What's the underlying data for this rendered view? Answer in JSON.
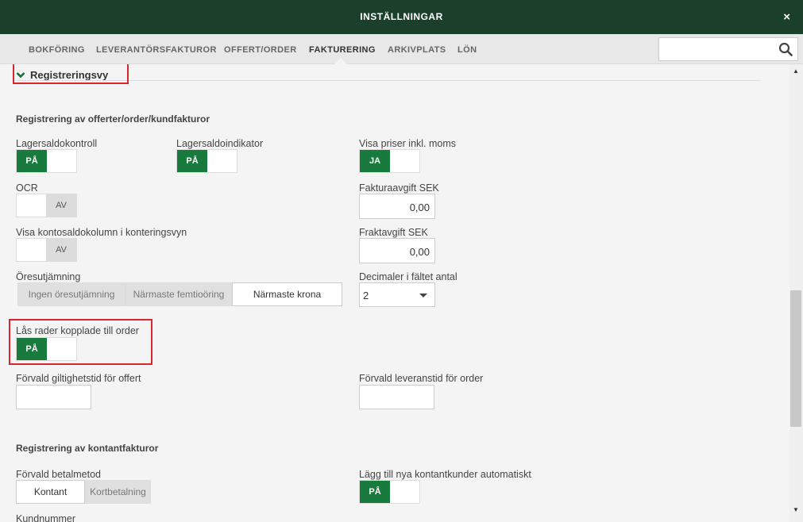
{
  "window": {
    "title": "INSTÄLLNINGAR",
    "close_icon": "×"
  },
  "tabs": [
    {
      "label": "BOKFÖRING"
    },
    {
      "label": "LEVERANTÖRSFAKTUROR"
    },
    {
      "label": "OFFERT/ORDER"
    },
    {
      "label": "FAKTURERING"
    },
    {
      "label": "ARKIVPLATS"
    },
    {
      "label": "LÖN"
    }
  ],
  "active_tab": "FAKTURERING",
  "search": {
    "placeholder": ""
  },
  "section": {
    "title": "Registreringsvy"
  },
  "group1": {
    "title": "Registrering av offerter/order/kundfakturor",
    "lagersaldokontroll": {
      "label": "Lagersaldokontroll",
      "state": "PÅ"
    },
    "lagersaldoindikator": {
      "label": "Lagersaldoindikator",
      "state": "PÅ"
    },
    "visa_priser": {
      "label": "Visa priser inkl. moms",
      "state": "JA"
    },
    "ocr": {
      "label": "OCR",
      "state": "AV"
    },
    "fakturaavgift": {
      "label": "Fakturaavgift SEK",
      "value": "0,00"
    },
    "kontosaldo": {
      "label": "Visa kontosaldokolumn i konteringsvyn",
      "state": "AV"
    },
    "fraktavgift": {
      "label": "Fraktavgift SEK",
      "value": "0,00"
    },
    "oresutjamning": {
      "label": "Öresutjämning",
      "options": [
        "Ingen öresutjämning",
        "Närmaste femtioöring",
        "Närmaste krona"
      ],
      "selected": "Närmaste krona"
    },
    "decimaler": {
      "label": "Decimaler i fältet antal",
      "value": "2"
    },
    "las_rader": {
      "label": "Lås rader kopplade till order",
      "state": "PÅ"
    },
    "giltighetstid": {
      "label": "Förvald giltighetstid för offert"
    },
    "leveranstid": {
      "label": "Förvald leveranstid för order"
    }
  },
  "group2": {
    "title": "Registrering av kontantfakturor",
    "betalmetod": {
      "label": "Förvald betalmetod",
      "options": [
        "Kontant",
        "Kortbetalning"
      ],
      "selected": "Kontant"
    },
    "nya_kunder": {
      "label": "Lägg till nya kontantkunder automatiskt",
      "state": "PÅ"
    },
    "kundnummer": {
      "label": "Kundnummer"
    }
  },
  "colors": {
    "header": "#1a3f2b",
    "toggle_on": "#187a3c",
    "highlight": "#d9262e"
  }
}
